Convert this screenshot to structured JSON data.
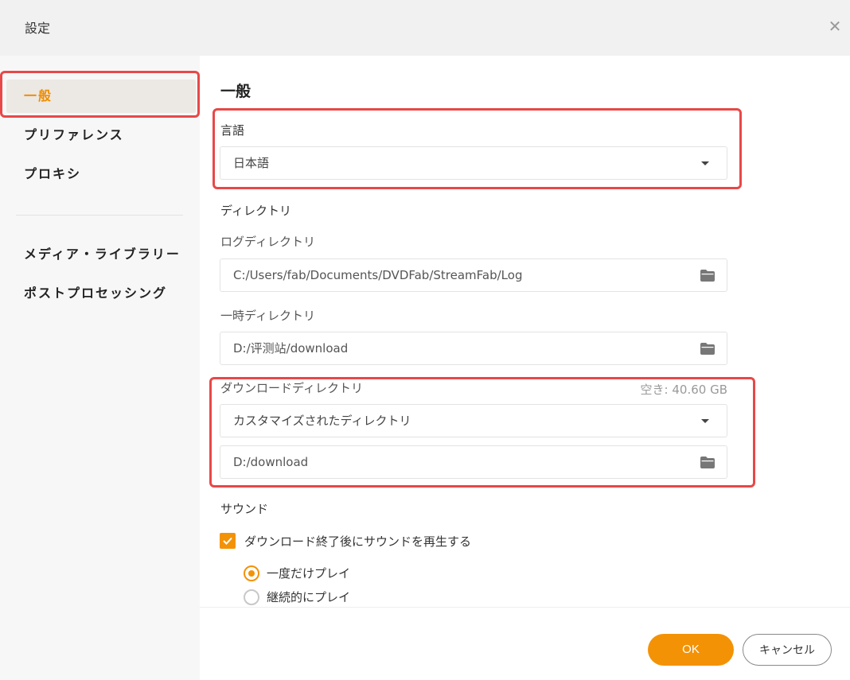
{
  "window": {
    "title": "設定",
    "close_icon": "close-icon"
  },
  "sidebar": {
    "items": [
      {
        "label": "一般",
        "active": true
      },
      {
        "label": "プリファレンス",
        "active": false
      },
      {
        "label": "プロキシ",
        "active": false
      },
      {
        "label": "メディア・ライブラリー",
        "active": false
      },
      {
        "label": "ポストプロセッシング",
        "active": false
      }
    ]
  },
  "main": {
    "heading": "一般",
    "language": {
      "label": "言語",
      "value": "日本語"
    },
    "directory": {
      "section_label": "ディレクトリ",
      "log": {
        "label": "ログディレクトリ",
        "value": "C:/Users/fab/Documents/DVDFab/StreamFab/Log"
      },
      "temp": {
        "label": "一時ディレクトリ",
        "value": "D:/评测站/download"
      },
      "download": {
        "label": "ダウンロードディレクトリ",
        "free_space": "空き: 40.60 GB",
        "mode": "カスタマイズされたディレクトリ",
        "value": "D:/download"
      }
    },
    "sound": {
      "section_label": "サウンド",
      "play_after_download": {
        "label": "ダウンロード終了後にサウンドを再生する",
        "checked": true
      },
      "options": [
        {
          "label": "一度だけプレイ",
          "selected": true
        },
        {
          "label": "継続的にプレイ",
          "selected": false
        }
      ]
    }
  },
  "footer": {
    "ok_label": "OK",
    "cancel_label": "キャンセル"
  },
  "colors": {
    "accent": "#f39205",
    "highlight": "#e84848"
  }
}
